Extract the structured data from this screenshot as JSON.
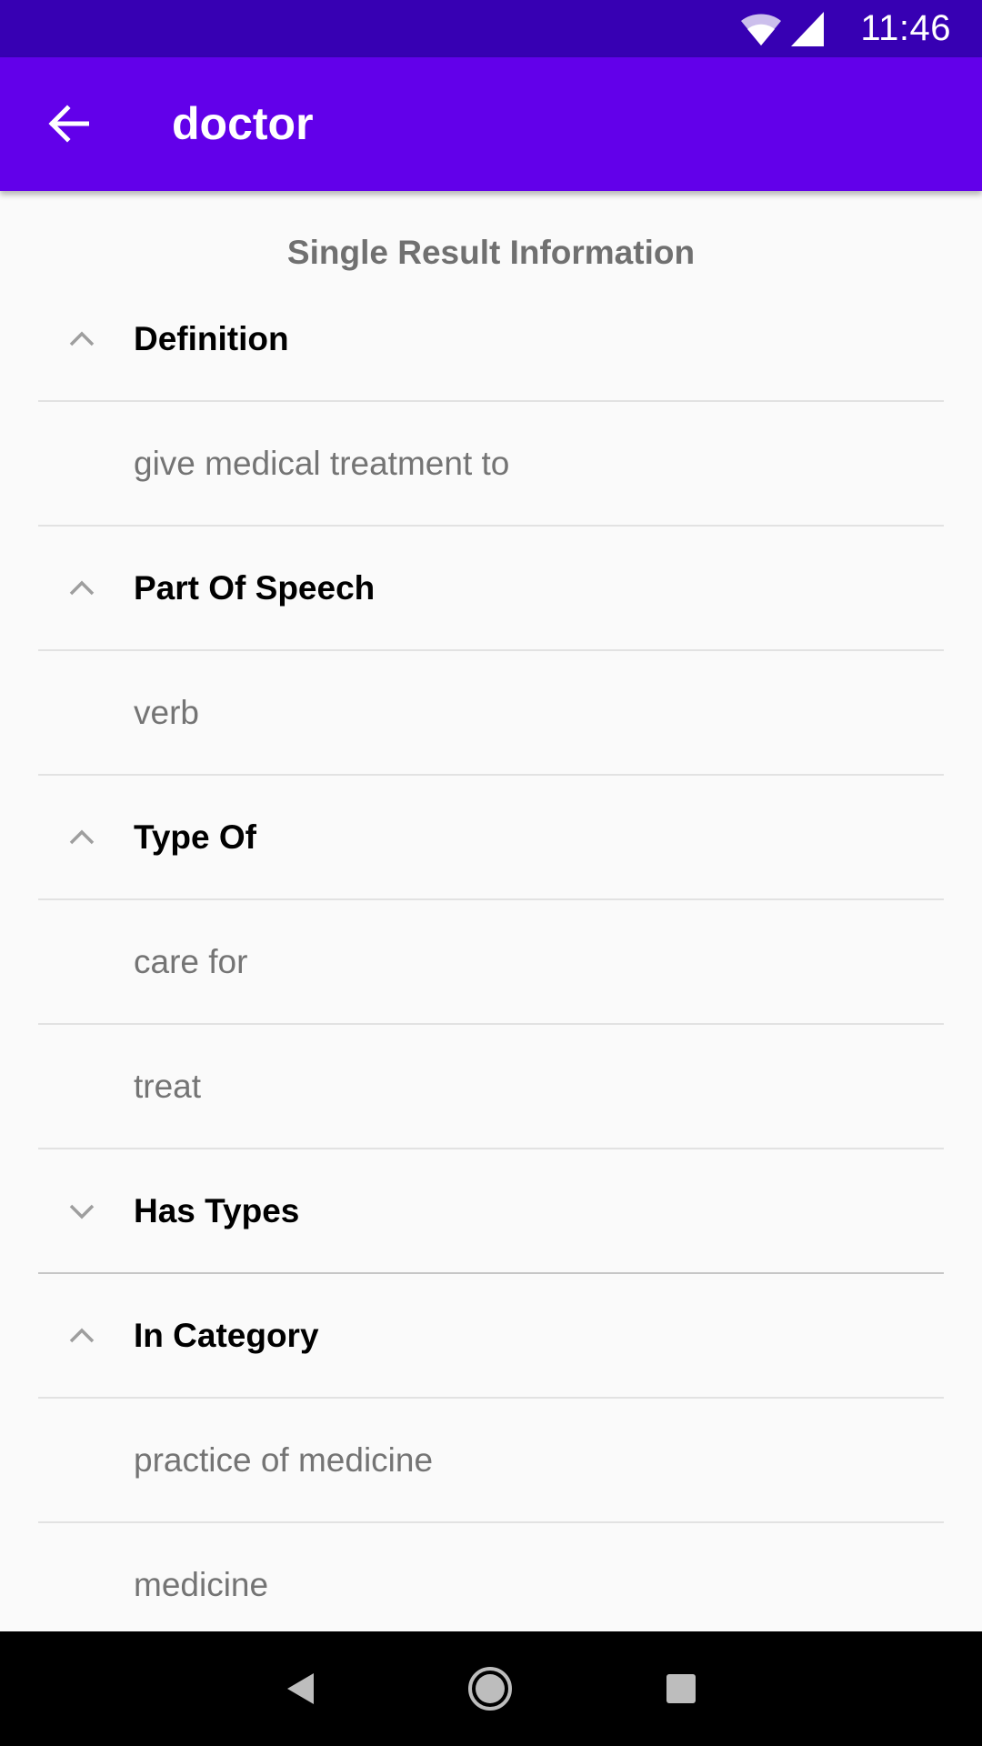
{
  "status_bar": {
    "time": "11:46",
    "icons": [
      "wifi-icon",
      "cell-signal-icon"
    ],
    "background": "#3700b3"
  },
  "app_bar": {
    "title": "doctor",
    "back_icon": "arrow-back-icon",
    "background": "#6200ea"
  },
  "content": {
    "heading": "Single Result Information",
    "sections": [
      {
        "header": "Definition",
        "expanded": true,
        "items": [
          "give medical treatment to"
        ]
      },
      {
        "header": "Part Of Speech",
        "expanded": true,
        "items": [
          "verb"
        ]
      },
      {
        "header": "Type Of",
        "expanded": true,
        "items": [
          "care for",
          "treat"
        ]
      },
      {
        "header": "Has Types",
        "expanded": false,
        "items": []
      },
      {
        "header": "In Category",
        "expanded": true,
        "items": [
          "practice of medicine",
          "medicine"
        ]
      }
    ]
  },
  "nav_bar": {
    "buttons": [
      "back-triangle-icon",
      "home-circle-icon",
      "recents-square-icon"
    ]
  },
  "colors": {
    "header_text": "#000000",
    "item_text": "#747474",
    "divider": "#e2e2e2",
    "chevron": "#9e9e9e"
  }
}
